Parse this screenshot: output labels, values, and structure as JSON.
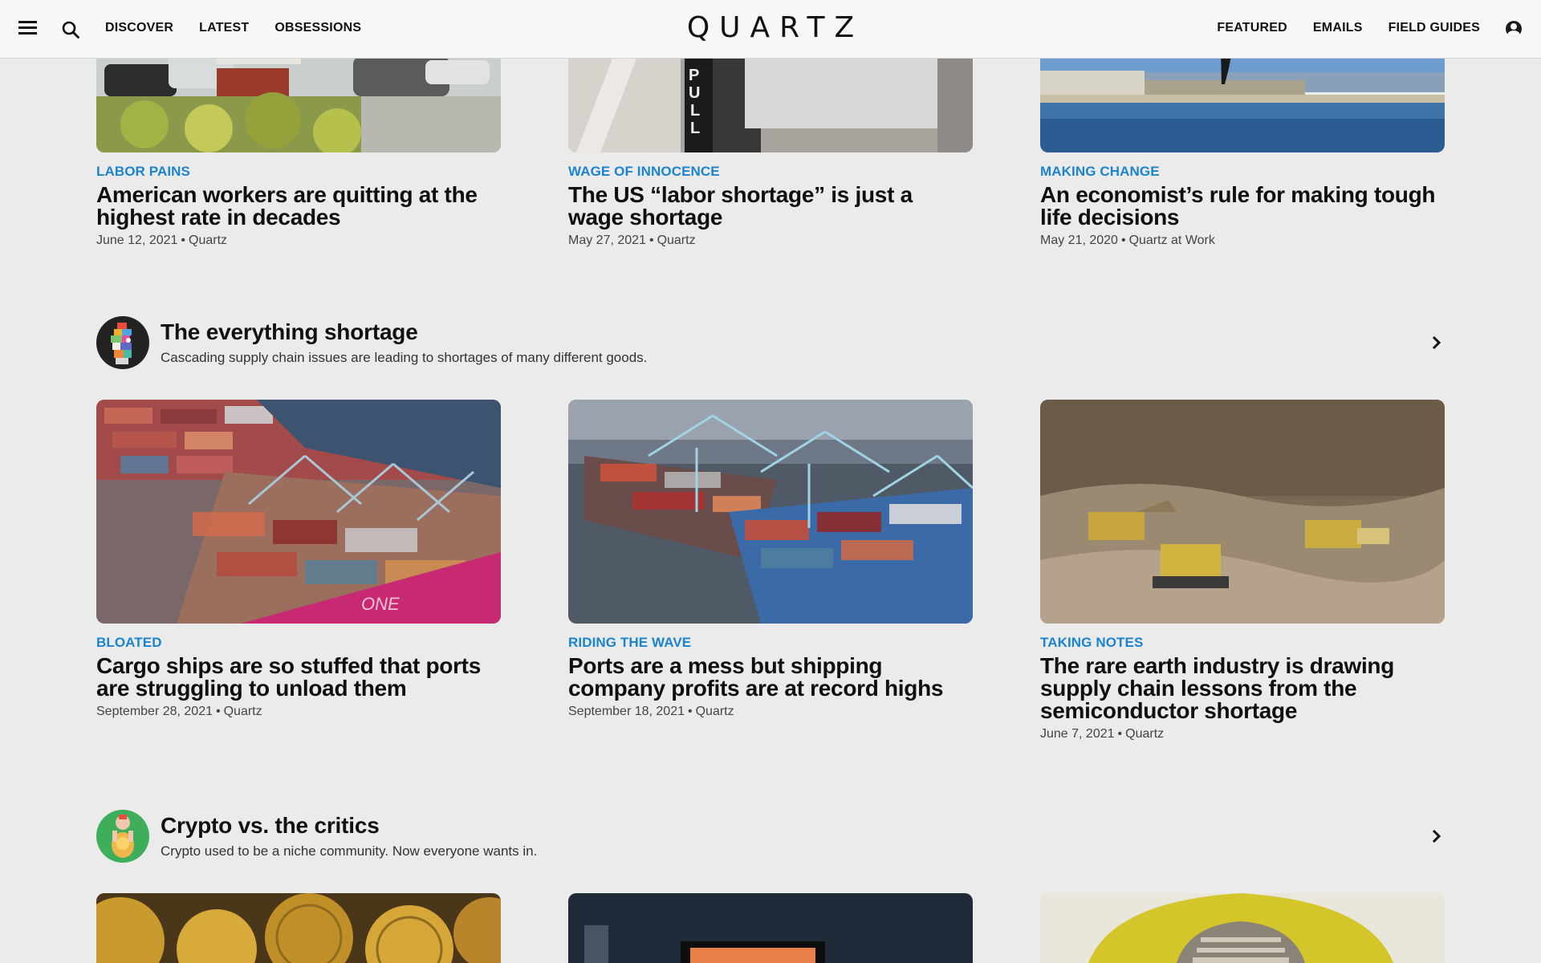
{
  "header": {
    "menu_icon": "hamburger-menu-icon",
    "search_icon": "search-icon",
    "nav_left": [
      "DISCOVER",
      "LATEST",
      "OBSESSIONS"
    ],
    "logo": "QUARTZ",
    "nav_right": [
      "FEATURED",
      "EMAILS",
      "FIELD GUIDES"
    ],
    "account_icon": "account-icon"
  },
  "top_row": [
    {
      "kicker": "LABOR PAINS",
      "headline": "American workers are quitting at the highest rate in decades",
      "date": "June 12, 2021",
      "source": "Quartz"
    },
    {
      "kicker": "WAGE OF INNOCENCE",
      "headline": "The US “labor shortage” is just a wage shortage",
      "date": "May 27, 2021",
      "source": "Quartz"
    },
    {
      "kicker": "MAKING CHANGE",
      "headline": "An economist’s rule for making tough life decisions",
      "date": "May 21, 2020",
      "source": "Quartz at Work"
    }
  ],
  "sections": [
    {
      "title": "The everything shortage",
      "description": "Cascading supply chain issues are leading to shortages of many different goods.",
      "articles": [
        {
          "kicker": "BLOATED",
          "headline": "Cargo ships are so stuffed that ports are struggling to unload them",
          "date": "September 28, 2021",
          "source": "Quartz"
        },
        {
          "kicker": "RIDING THE WAVE",
          "headline": "Ports are a mess but shipping company profits are at record highs",
          "date": "September 18, 2021",
          "source": "Quartz"
        },
        {
          "kicker": "TAKING NOTES",
          "headline": "The rare earth industry is drawing supply chain lessons from the semiconductor shortage",
          "date": "June 7, 2021",
          "source": "Quartz"
        }
      ]
    },
    {
      "title": "Crypto vs. the critics",
      "description": "Crypto used to be a niche community. Now everyone wants in."
    }
  ],
  "colors": {
    "kicker": "#1b84d0",
    "background": "#ebebeb",
    "header_bg": "#f8f8f8"
  }
}
